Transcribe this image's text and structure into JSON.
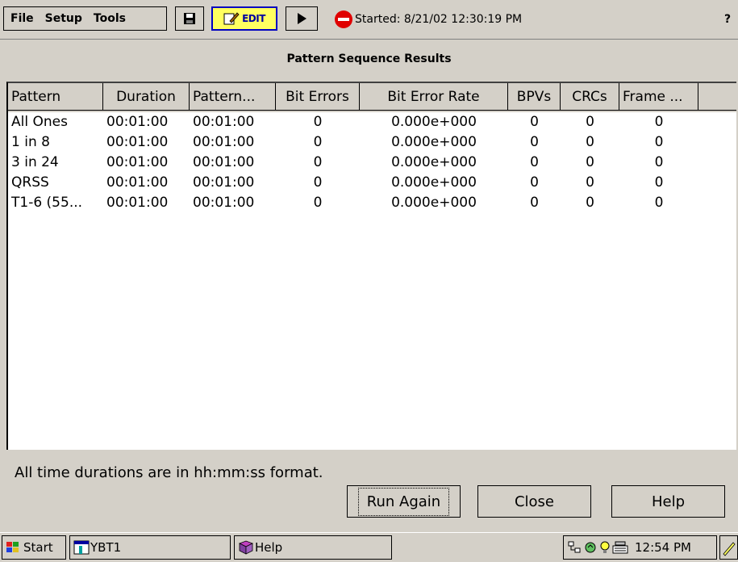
{
  "toolbar": {
    "menu": {
      "file": "File",
      "setup": "Setup",
      "tools": "Tools"
    },
    "edit_label": "EDIT",
    "started": "Started: 8/21/02 12:30:19 PM",
    "help_q": "?"
  },
  "title": "Pattern Sequence Results",
  "table": {
    "headers": [
      "Pattern",
      "Duration",
      "Pattern...",
      "Bit Errors",
      "Bit Error Rate",
      "BPVs",
      "CRCs",
      "Frame ...",
      ""
    ],
    "rows": [
      [
        "All Ones",
        "00:01:00",
        "00:01:00",
        "0",
        "0.000e+000",
        "0",
        "0",
        "0"
      ],
      [
        "1 in 8",
        "00:01:00",
        "00:01:00",
        "0",
        "0.000e+000",
        "0",
        "0",
        "0"
      ],
      [
        "3 in 24",
        "00:01:00",
        "00:01:00",
        "0",
        "0.000e+000",
        "0",
        "0",
        "0"
      ],
      [
        "QRSS",
        "00:01:00",
        "00:01:00",
        "0",
        "0.000e+000",
        "0",
        "0",
        "0"
      ],
      [
        "T1-6 (55...",
        "00:01:00",
        "00:01:00",
        "0",
        "0.000e+000",
        "0",
        "0",
        "0"
      ]
    ]
  },
  "note": "All time durations are in hh:mm:ss format.",
  "buttons": {
    "run_again": "Run Again",
    "close": "Close",
    "help": "Help"
  },
  "taskbar": {
    "start": "Start",
    "ybt": "YBT1",
    "help": "Help",
    "clock": "12:54 PM"
  }
}
